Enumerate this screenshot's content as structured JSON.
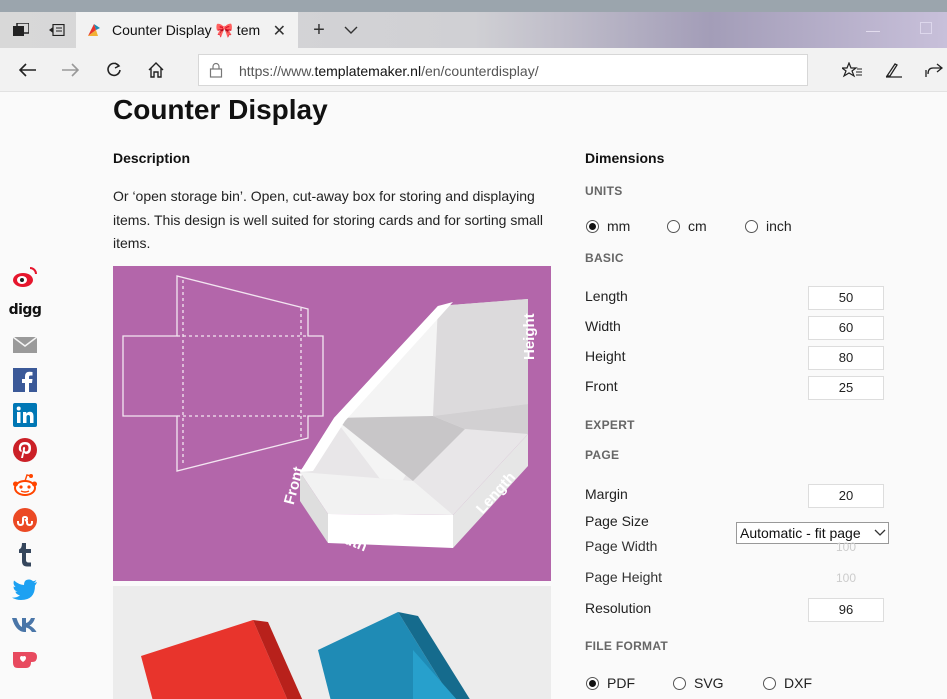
{
  "browser": {
    "tab_title": "Counter Display 🎀 tem",
    "url_prefix": "https://www.",
    "url_domain": "templatemaker.nl",
    "url_path": "/en/counterdisplay/"
  },
  "page": {
    "title": "Counter Display",
    "description_heading": "Description",
    "description_text": "Or ‘open storage bin’. Open, cut-away box for storing and displaying items. This design is well suited for storing cards and for sorting small items.",
    "illustration_labels": {
      "height": "Height",
      "front": "Front",
      "width": "Width",
      "length": "Length"
    }
  },
  "dimensions": {
    "heading": "Dimensions",
    "units_label": "UNITS",
    "units": [
      {
        "label": "mm",
        "selected": true
      },
      {
        "label": "cm",
        "selected": false
      },
      {
        "label": "inch",
        "selected": false
      }
    ],
    "basic_label": "BASIC",
    "basic_fields": [
      {
        "label": "Length",
        "value": "50"
      },
      {
        "label": "Width",
        "value": "60"
      },
      {
        "label": "Height",
        "value": "80"
      },
      {
        "label": "Front",
        "value": "25"
      }
    ],
    "expert_label": "EXPERT",
    "page_label": "PAGE",
    "margin_label": "Margin",
    "margin_value": "20",
    "page_size_label": "Page Size",
    "page_size_value": "Automatic - fit page",
    "page_width_label": "Page Width",
    "page_width_value": "100",
    "page_height_label": "Page Height",
    "page_height_value": "100",
    "resolution_label": "Resolution",
    "resolution_value": "96",
    "file_format_label": "FILE FORMAT",
    "file_formats": [
      {
        "label": "PDF",
        "selected": true
      },
      {
        "label": "SVG",
        "selected": false
      },
      {
        "label": "DXF",
        "selected": false
      }
    ]
  },
  "social": [
    {
      "icon": "weibo-icon",
      "color": "#e6162d"
    },
    {
      "icon": "digg-icon",
      "color": "#111111"
    },
    {
      "icon": "email-icon",
      "color": "#8a8a8a"
    },
    {
      "icon": "facebook-icon",
      "color": "#3b5998"
    },
    {
      "icon": "linkedin-icon",
      "color": "#0077b5"
    },
    {
      "icon": "pinterest-icon",
      "color": "#cb2027"
    },
    {
      "icon": "reddit-icon",
      "color": "#ff4500"
    },
    {
      "icon": "stumbleupon-icon",
      "color": "#eb4924"
    },
    {
      "icon": "tumblr-icon",
      "color": "#35465c"
    },
    {
      "icon": "twitter-icon",
      "color": "#1da1f2"
    },
    {
      "icon": "vk-icon",
      "color": "#4a76a8"
    },
    {
      "icon": "kofi-icon",
      "color": "#e84a5f"
    }
  ],
  "colors": {
    "illustration_bg": "#b366aa",
    "box_red": "#e8342c",
    "box_blue": "#1f8bb5"
  }
}
